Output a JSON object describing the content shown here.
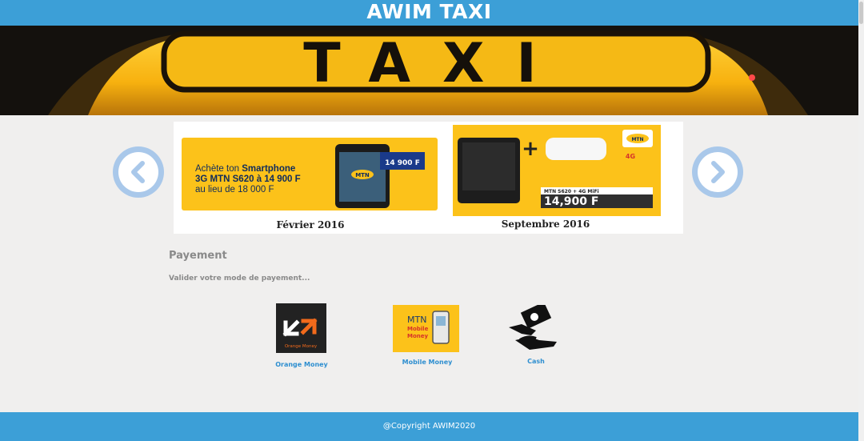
{
  "app": {
    "title": "AWIM TAXI"
  },
  "banner": {
    "sign_text": "TAXI"
  },
  "carousel": {
    "slides": [
      {
        "caption": "Février 2016",
        "ad": {
          "line1": "Achète ton ",
          "line1_bold": "Smartphone",
          "line2": "3G MTN S620 à 14 900 F",
          "line3": "au lieu de 18 000 F",
          "price_tag": "14 900 F",
          "brand": "MTN"
        }
      },
      {
        "caption": "Septembre 2016",
        "ad": {
          "brand": "MTN",
          "badge": "4G",
          "product": "MTN S620 + 4G MiFi",
          "price": "14,900 F"
        }
      }
    ],
    "prev_icon": "chevron-left-icon",
    "next_icon": "chevron-right-icon"
  },
  "payment": {
    "title": "Payement",
    "subtitle": "Valider votre mode de payement...",
    "methods": [
      {
        "label": "Orange Money",
        "logo_text": "Orange Money",
        "icon": "orange-money-logo"
      },
      {
        "label": "Mobile Money",
        "logo_text_1": "MTN",
        "logo_text_2": "Mobile",
        "logo_text_3": "Money",
        "icon": "mtn-mobile-money-logo"
      },
      {
        "label": "Cash",
        "icon": "hand-cash-icon"
      }
    ]
  },
  "footer": {
    "copyright": "@Copyright AWIM2020"
  },
  "colors": {
    "header": "#3c9fd7",
    "accent_yellow": "#fcc21a",
    "link": "#2f8fd0"
  }
}
